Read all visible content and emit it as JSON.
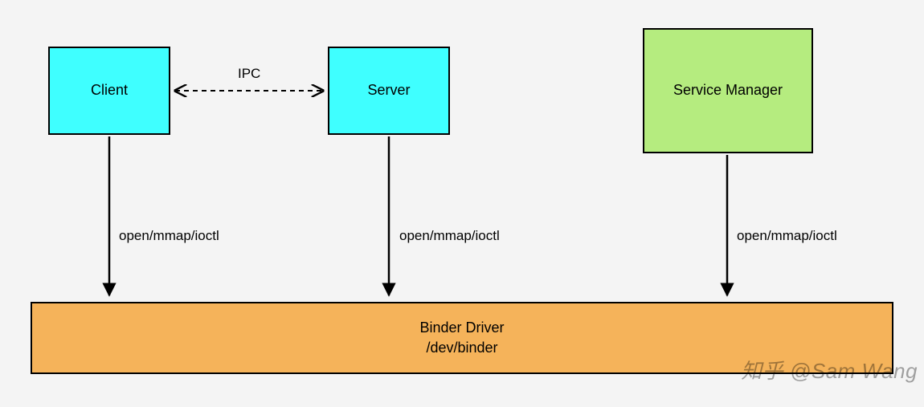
{
  "boxes": {
    "client": "Client",
    "server": "Server",
    "service_manager": "Service Manager",
    "driver_line1": "Binder Driver",
    "driver_line2": "/dev/binder"
  },
  "labels": {
    "ipc": "IPC",
    "client_arrow": "open/mmap/ioctl",
    "server_arrow": "open/mmap/ioctl",
    "sm_arrow": "open/mmap/ioctl"
  },
  "watermark": "知乎 @Sam Wang",
  "colors": {
    "cyan": "#3fffff",
    "green": "#b5ec7f",
    "orange": "#f5b35a"
  }
}
